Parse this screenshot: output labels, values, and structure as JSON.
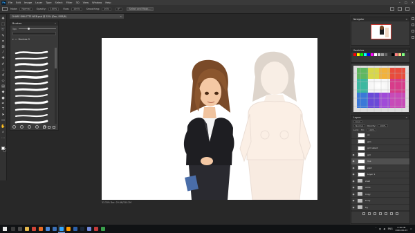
{
  "menu": {
    "app_logo": "Ps",
    "items": [
      "File",
      "Edit",
      "Image",
      "Layer",
      "Type",
      "Select",
      "Filter",
      "3D",
      "View",
      "Window",
      "Help"
    ],
    "window_controls": [
      "–",
      "□",
      "✕"
    ]
  },
  "options_bar": {
    "mode_label": "Mode:",
    "mode_value": "Normal",
    "opacity_label": "Opacity:",
    "opacity_value": "100%",
    "flow_label": "Flow:",
    "flow_value": "100%",
    "smoothing_label": "Smoothing:",
    "smoothing_value": "10%",
    "angle_value": "0°",
    "select_mask_label": "Select and Mask..."
  },
  "document": {
    "tab_title": "CHARE SMILETTE WEB.psd @ 33% (Doc, RGB/8)",
    "tab_close": "✕",
    "status_text": "33.33%    Doc: 29.4M/310.2M"
  },
  "brushes_panel": {
    "title": "Brushes",
    "close": "»",
    "size_value": "5px",
    "group_name": "Brushes G"
  },
  "navigator_panel": {
    "title": "Navigator",
    "menu": "≡"
  },
  "swatches_panel": {
    "title": "Swatches",
    "menu": "≡",
    "colors": [
      "#ff0000",
      "#ffff00",
      "#00ff00",
      "#00ffff",
      "#0000ff",
      "#ff00ff",
      "#ffffff",
      "#cccccc",
      "#999999",
      "#666666",
      "#333333",
      "#000000",
      "#ff8080",
      "#ffd080",
      "#80ff80"
    ]
  },
  "color_panel": {
    "accent": "#e94c3c"
  },
  "layers_panel": {
    "title": "Layers",
    "menu": "≡",
    "kind_label": "Kind",
    "blend_mode": "Normal",
    "opacity_label": "Opacity:",
    "opacity_value": "100%",
    "lock_label": "Lock:",
    "fill_label": "Fill:",
    "fill_value": "100%",
    "layers": [
      {
        "name": "a1",
        "type": "layer",
        "visible": false,
        "selected": false
      },
      {
        "name": "ghn",
        "type": "layer",
        "visible": false,
        "selected": false
      },
      {
        "name": "girl naked",
        "type": "layer",
        "visible": false,
        "selected": false
      },
      {
        "name": "girl",
        "type": "layer",
        "visible": true,
        "selected": false
      },
      {
        "name": "line",
        "type": "layer",
        "visible": true,
        "selected": true
      },
      {
        "name": "shirt",
        "type": "layer",
        "visible": true,
        "selected": false
      },
      {
        "name": "Layer 1",
        "type": "layer",
        "visible": true,
        "selected": false
      },
      {
        "name": "shad",
        "type": "folder",
        "visible": true,
        "selected": false
      },
      {
        "name": "arms",
        "type": "folder",
        "visible": true,
        "selected": false
      },
      {
        "name": "Copy",
        "type": "folder",
        "visible": true,
        "selected": false
      },
      {
        "name": "body",
        "type": "folder",
        "visible": true,
        "selected": false
      },
      {
        "name": "bg",
        "type": "folder",
        "visible": true,
        "selected": false
      }
    ]
  },
  "taskbar": {
    "icons": [
      {
        "name": "search",
        "color": "#3a3a3a"
      },
      {
        "name": "task-view",
        "color": "#4a4a4a"
      },
      {
        "name": "explorer",
        "color": "#e5b84c"
      },
      {
        "name": "chrome",
        "color": "#d04437"
      },
      {
        "name": "firefox",
        "color": "#e86c24"
      },
      {
        "name": "store",
        "color": "#4a88d8"
      },
      {
        "name": "mail",
        "color": "#3b6fb5"
      },
      {
        "name": "photoshop",
        "color": "#31a8ff"
      },
      {
        "name": "illustrator",
        "color": "#ff9a00"
      },
      {
        "name": "app-blue",
        "color": "#2c5fa8"
      },
      {
        "name": "steam",
        "color": "#1b2838"
      },
      {
        "name": "discord",
        "color": "#7289da"
      },
      {
        "name": "app-red",
        "color": "#c33b3b"
      },
      {
        "name": "app-green",
        "color": "#3aa04b"
      }
    ],
    "language": "ENG",
    "time": "2:16 PM",
    "date": "2020-06-03"
  }
}
